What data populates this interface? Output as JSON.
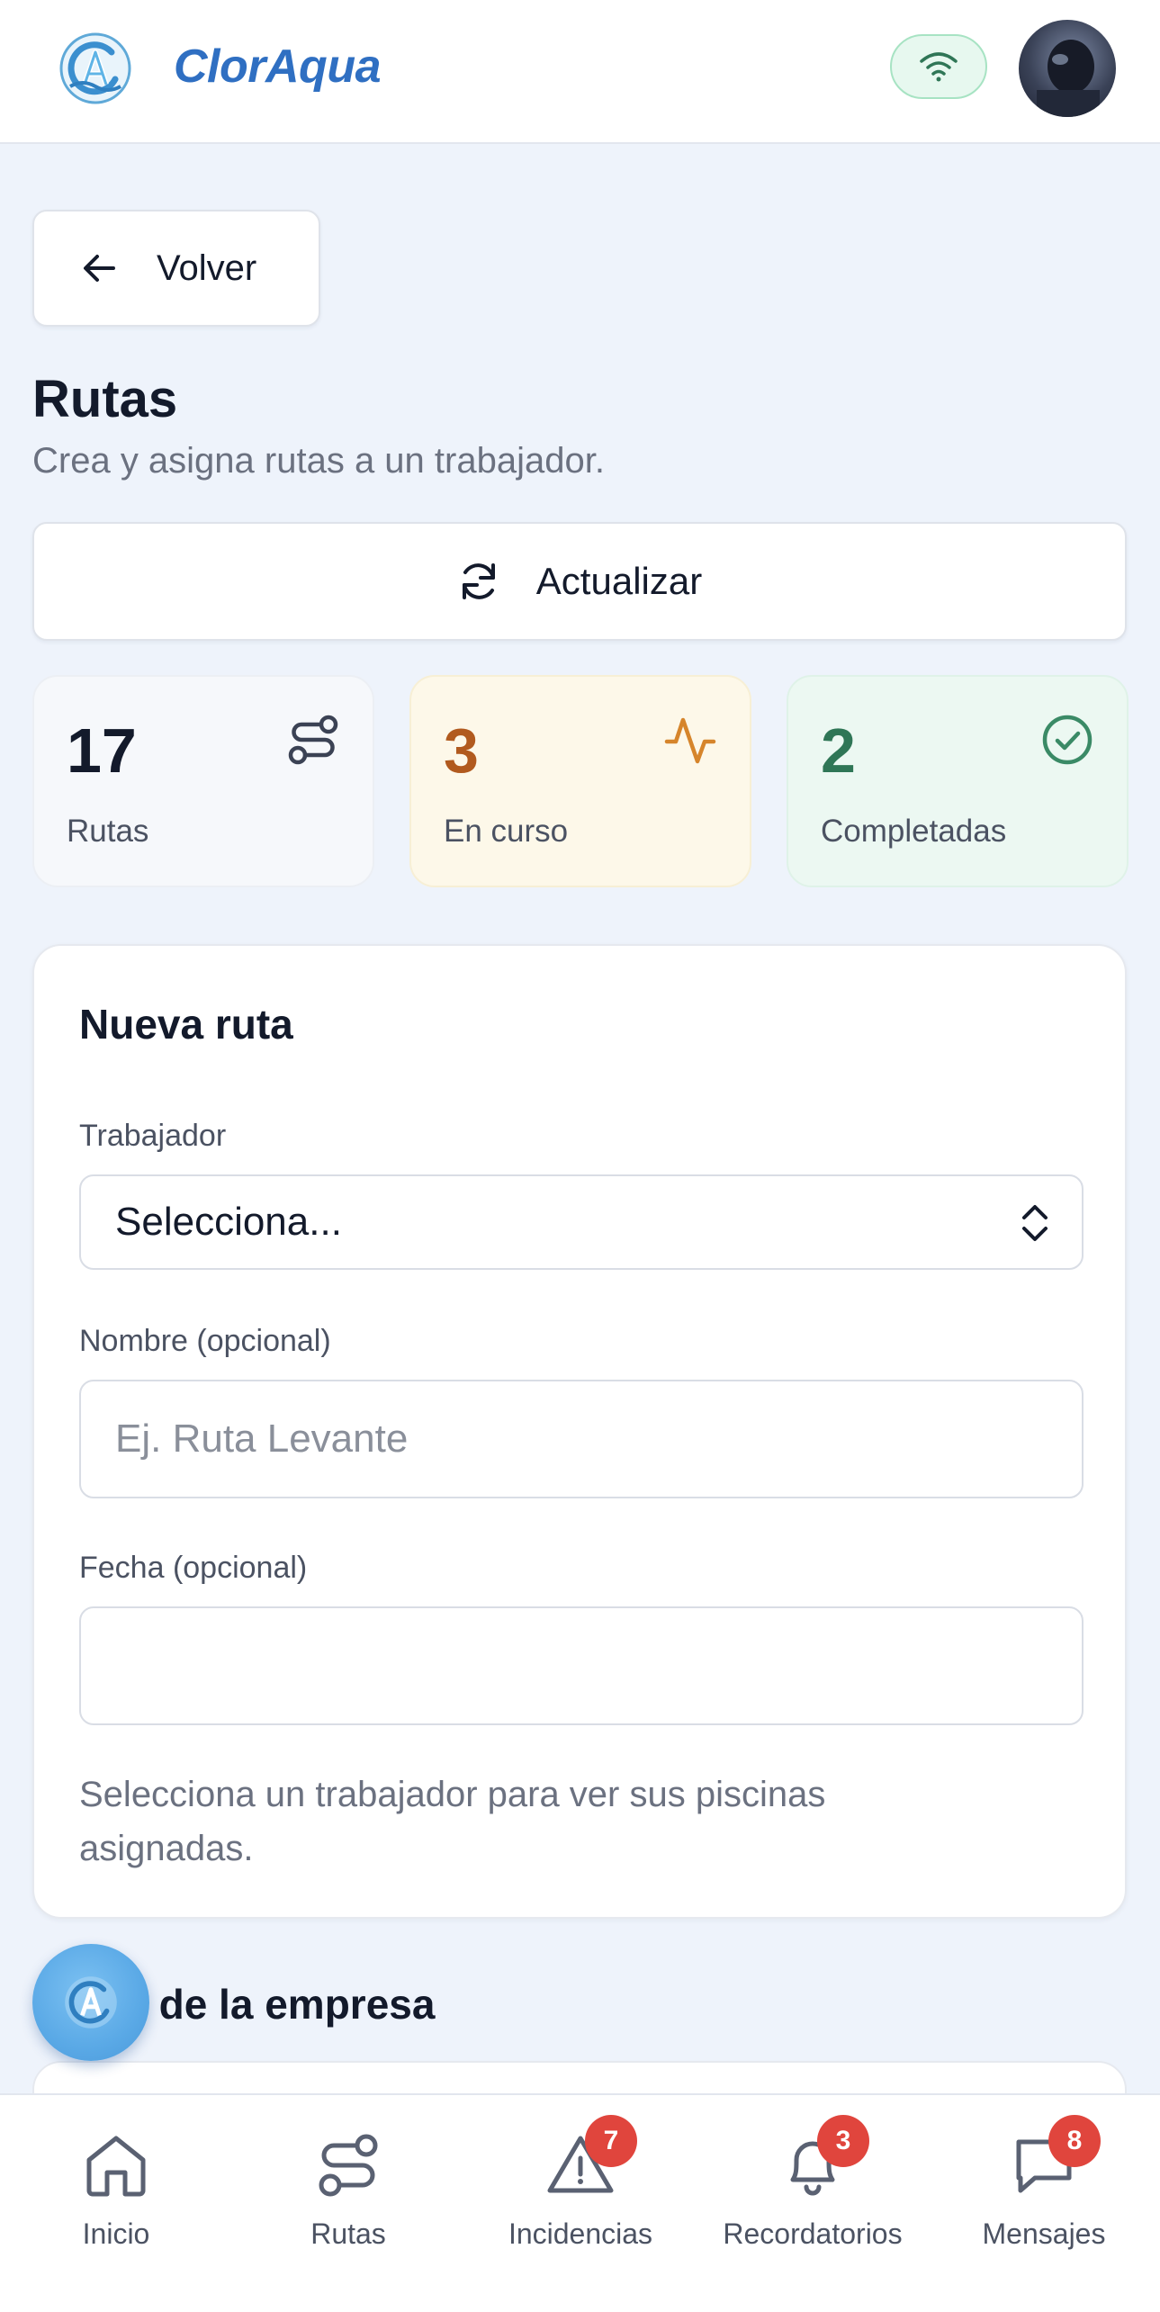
{
  "header": {
    "brand": "ClorAqua",
    "logo_icon": "cloraqua-logo-icon",
    "connection_icon": "wifi-icon",
    "avatar_icon": "user-avatar"
  },
  "back_button": {
    "label": "Volver",
    "icon": "arrow-left-icon"
  },
  "page": {
    "title": "Rutas",
    "subtitle": "Crea y asigna rutas a un trabajador."
  },
  "refresh_button": {
    "label": "Actualizar",
    "icon": "refresh-icon"
  },
  "stats": [
    {
      "value": "17",
      "label": "Rutas",
      "icon": "route-icon",
      "color": "#131a2b"
    },
    {
      "value": "3",
      "label": "En curso",
      "icon": "activity-icon",
      "color": "#b15a1e"
    },
    {
      "value": "2",
      "label": "Completadas",
      "icon": "check-circle-icon",
      "color": "#2f7656"
    }
  ],
  "form": {
    "title": "Nueva ruta",
    "worker_label": "Trabajador",
    "worker_value": "Selecciona...",
    "name_label": "Nombre (opcional)",
    "name_placeholder": "Ej. Ruta Levante",
    "date_label": "Fecha (opcional)",
    "date_value": "",
    "hint": "Selecciona un trabajador para ver sus piscinas asignadas."
  },
  "section": {
    "title": "Rutas de la empresa",
    "visible_fragment": "s de la empresa"
  },
  "bottom_nav": [
    {
      "label": "Inicio",
      "icon": "home-icon",
      "badge": ""
    },
    {
      "label": "Rutas",
      "icon": "route-icon",
      "badge": ""
    },
    {
      "label": "Incidencias",
      "icon": "alert-triangle-icon",
      "badge": "7"
    },
    {
      "label": "Recordatorios",
      "icon": "bell-icon",
      "badge": "3"
    },
    {
      "label": "Mensajes",
      "icon": "message-icon",
      "badge": "8"
    }
  ],
  "colors": {
    "brand": "#2f6fc2",
    "background": "#eef3fb",
    "badge": "#e0453d"
  }
}
